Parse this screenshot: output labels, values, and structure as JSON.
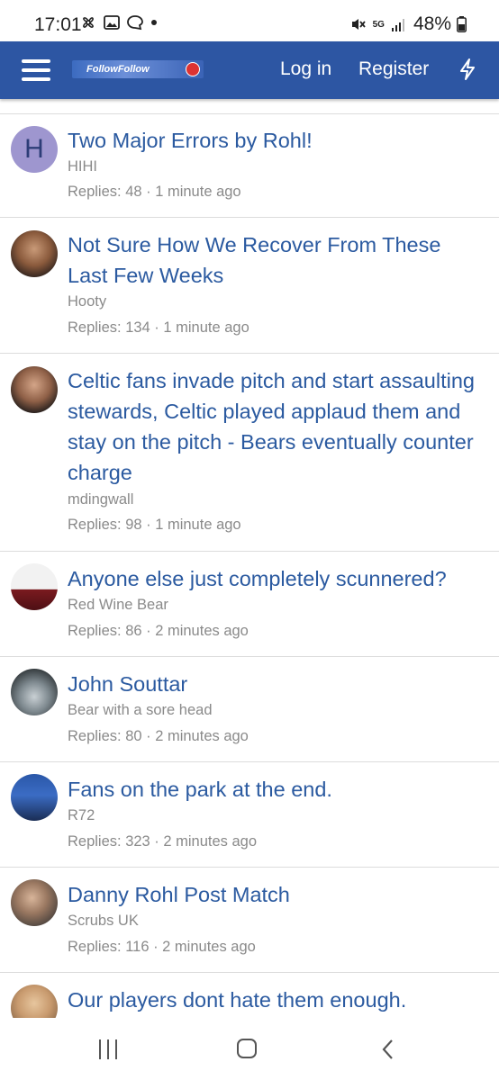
{
  "status_bar": {
    "time": "17:01",
    "icons": [
      "fan-icon",
      "image-icon",
      "chat-bubble-icon",
      "dot-icon"
    ],
    "network": "5G",
    "battery": "48%"
  },
  "header": {
    "logo_text": "FollowFollow",
    "login_label": "Log in",
    "register_label": "Register",
    "whats_new_icon": "bolt-icon",
    "brand_color": "#2d56a3"
  },
  "threads": [
    {
      "title": "Two Major Errors by Rohl!",
      "author": "HIHI",
      "meta": "Replies: 48 · 1 minute ago",
      "avatar_letter": "H"
    },
    {
      "title": "Not Sure How We Recover From These Last Few Weeks",
      "author": "Hooty",
      "meta": "Replies: 134 · 1 minute ago"
    },
    {
      "title": "Celtic fans invade pitch and start assaulting stewards, Celtic played applaud them and stay on the pitch - Bears eventually counter charge",
      "author": "mdingwall",
      "meta": "Replies: 98 · 1 minute ago"
    },
    {
      "title": "Anyone else just completely scunnered?",
      "author": "Red Wine Bear",
      "meta": "Replies: 86 · 2 minutes ago"
    },
    {
      "title": "John Souttar",
      "author": "Bear with a sore head",
      "meta": "Replies: 80 · 2 minutes ago"
    },
    {
      "title": "Fans on the park at the end.",
      "author": "R72",
      "meta": "Replies: 323 · 2 minutes ago"
    },
    {
      "title": "Danny Rohl Post Match",
      "author": "Scrubs UK",
      "meta": "Replies: 116 · 2 minutes ago"
    },
    {
      "title": "Our players dont hate them enough.",
      "author": "",
      "meta": ""
    }
  ],
  "nav": {
    "recent_icon": "recent-apps-icon",
    "home_icon": "home-icon",
    "back_icon": "back-icon"
  }
}
